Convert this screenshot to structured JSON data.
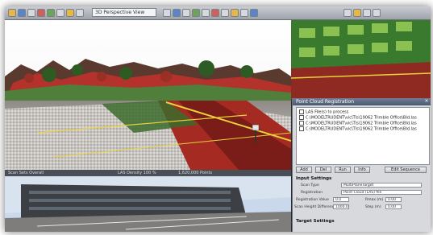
{
  "toolbar": {
    "view_select": "3D Perspective View",
    "icons": [
      "open-icon",
      "save-icon",
      "undo-icon",
      "select-icon",
      "zoom-icon",
      "pan-icon",
      "orbit-icon",
      "layers-icon",
      "settings-icon"
    ]
  },
  "viewport": {
    "status_left": "Scan Sets Overall",
    "status_mid": "LAS Density 100 %",
    "status_right": "1,620,000 Points"
  },
  "panel": {
    "title": "Point Cloud Registration",
    "list_header": "LAS File(s) to process",
    "files": [
      "C:\\MODELTRUDENT\\vic\\Tls\\19062 Trimble Office\\Bld.las",
      "C:\\MODELTRUDENT\\vic\\Tls\\19062 Trimble Office\\Bld.las",
      "C:\\MODELTRUDENT\\vic\\Tls\\19062 Trimble Office\\Bld.las"
    ],
    "buttons": [
      "Add",
      "Del",
      "Run",
      "Info",
      "Edit Sequence"
    ],
    "input_section": "Input Settings",
    "target_section": "Target Settings",
    "fields": [
      {
        "label": "Scan Type",
        "value": "MultiPlaneTarget"
      },
      {
        "label": "Registration",
        "value": "Point Cloud (LAS) file"
      },
      {
        "label": "Registration Value",
        "value": "0.0"
      },
      {
        "label": "Scan Height Difference",
        "value": "1000.0"
      }
    ],
    "fields_right": [
      {
        "label": "Rmax (m)",
        "value": "0.00"
      },
      {
        "label": "Step (m)",
        "value": "0.00"
      }
    ]
  }
}
